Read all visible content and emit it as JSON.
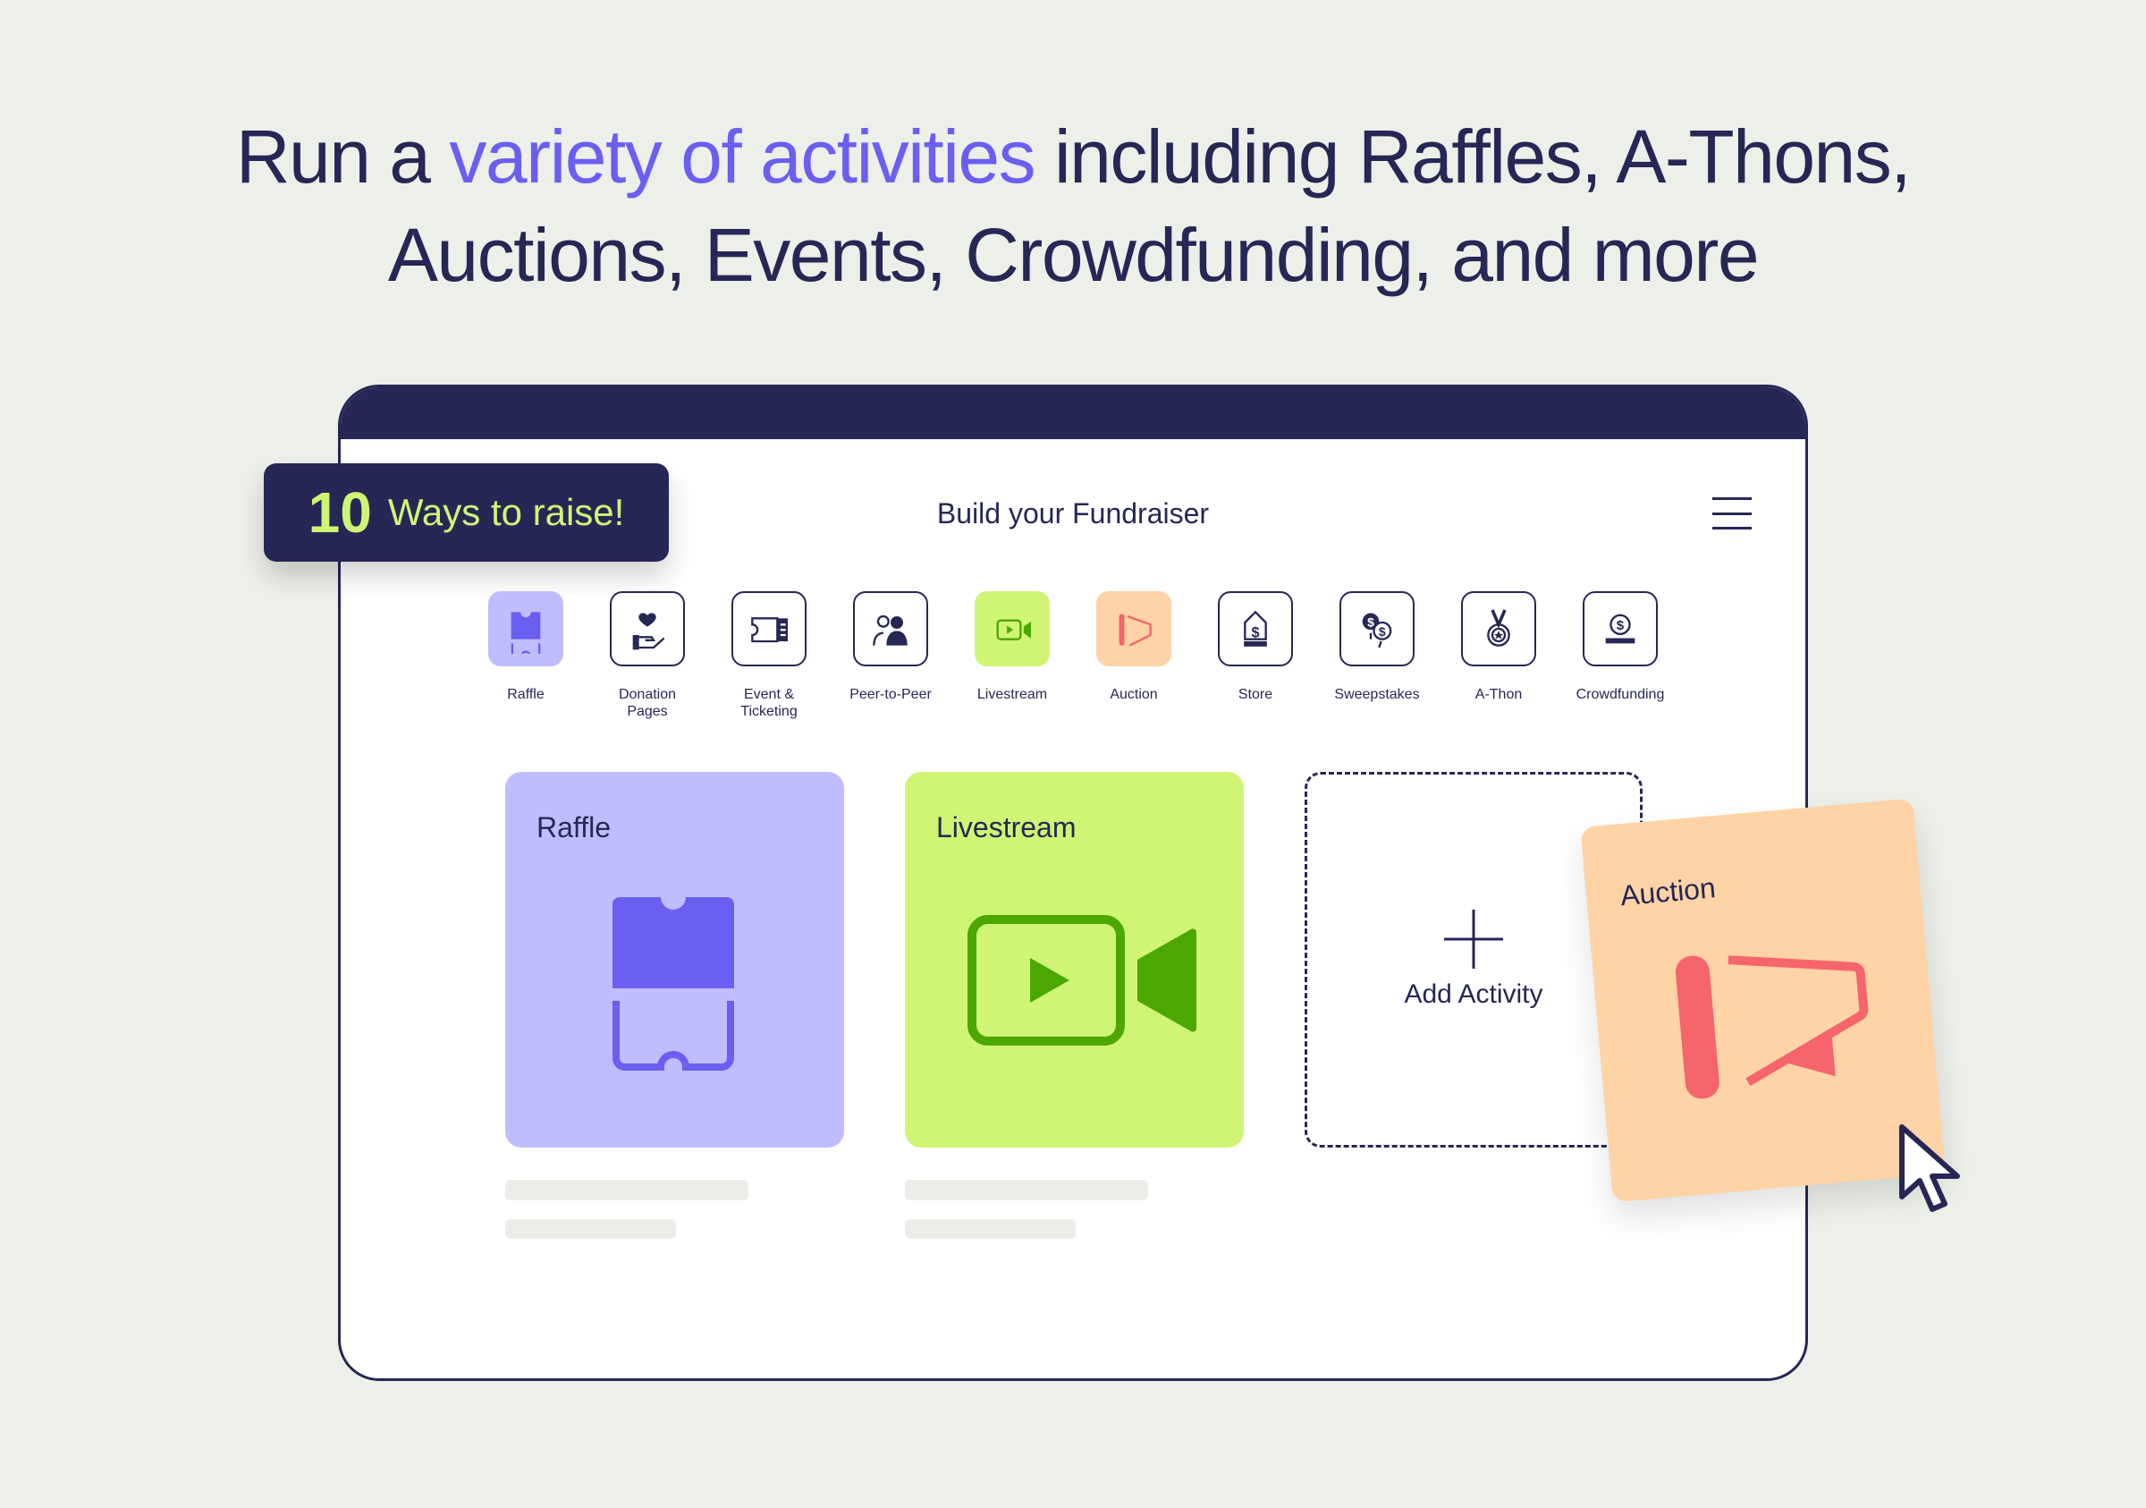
{
  "headline": {
    "pre": "Run a ",
    "accent": "variety of activities",
    "post": " including Raffles, A-Thons,",
    "line2": "Auctions, Events, Crowdfunding, and more"
  },
  "badge": {
    "number": "10",
    "text": "Ways to raise!"
  },
  "builder": {
    "title": "Build your Fundraiser",
    "menu_icon": "hamburger-icon"
  },
  "activities": [
    {
      "label": "Raffle",
      "icon": "ticket-icon",
      "selected": true,
      "color": "#c0bdff"
    },
    {
      "label": "Donation Pages",
      "icon": "hand-heart-icon"
    },
    {
      "label": "Event & Ticketing",
      "icon": "event-ticket-icon"
    },
    {
      "label": "Peer-to-Peer",
      "icon": "people-icon"
    },
    {
      "label": "Livestream",
      "icon": "video-camera-icon",
      "selected": true,
      "color": "#d0f575"
    },
    {
      "label": "Auction",
      "icon": "megaphone-icon",
      "selected": true,
      "color": "#fed3a6"
    },
    {
      "label": "Store",
      "icon": "price-tag-icon"
    },
    {
      "label": "Sweepstakes",
      "icon": "coins-icon"
    },
    {
      "label": "A-Thon",
      "icon": "medal-icon"
    },
    {
      "label": "Crowdfunding",
      "icon": "coin-stack-icon"
    }
  ],
  "cards": {
    "raffle": "Raffle",
    "livestream": "Livestream",
    "add": "Add Activity",
    "auction": "Auction"
  },
  "colors": {
    "navy": "#262755",
    "accent": "#6a5ff0",
    "lime": "#d0f575",
    "lavender": "#c0bdff",
    "peach": "#fed3a6",
    "coral": "#f6646c",
    "green": "#4ca700"
  }
}
